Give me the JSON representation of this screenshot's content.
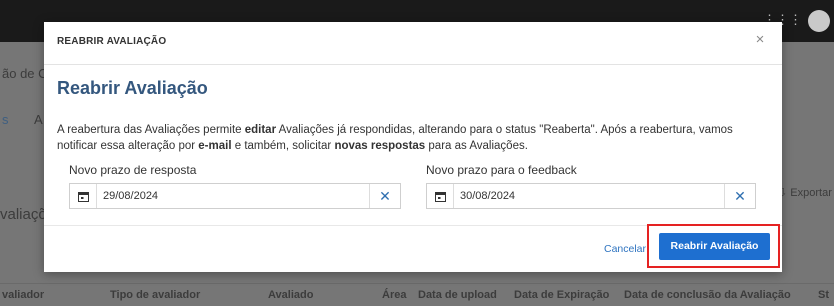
{
  "background": {
    "title_fragment": "ão de C",
    "tab_fragment_1": "s",
    "tab_fragment_2": "A",
    "section_fragment": "valiaçõ",
    "export_label": "Exportar",
    "columns": [
      "valiador",
      "Tipo de avaliador",
      "Avaliado",
      "Área",
      "Data de upload",
      "Data de Expiração",
      "Data de conclusão da Avaliação",
      "St"
    ]
  },
  "modal": {
    "header": "REABRIR AVALIAÇÃO",
    "close_label": "×",
    "title": "Reabrir Avaliação",
    "description": {
      "p1": "A reabertura das Avaliações permite ",
      "b1": "editar",
      "p2": " Avaliações já respondidas, alterando para o status \"Reaberta\". Após a reabertura, vamos notificar essa alteração por ",
      "b2": "e-mail",
      "p3": " e também, solicitar ",
      "b3": "novas respostas",
      "p4": " para as Avaliações."
    },
    "response_deadline": {
      "label": "Novo prazo de resposta",
      "value": "29/08/2024"
    },
    "feedback_deadline": {
      "label": "Novo prazo para o feedback",
      "value": "30/08/2024"
    },
    "clear_label": "✕",
    "cancel_label": "Cancelar",
    "confirm_label": "Reabrir Avaliação"
  },
  "colors": {
    "accent": "#1e6fd0",
    "title": "#34577e",
    "highlight": "#e52222"
  },
  "icons": [
    "grid-icon",
    "calendar-icon",
    "close-icon",
    "clear-icon",
    "export-icon"
  ]
}
